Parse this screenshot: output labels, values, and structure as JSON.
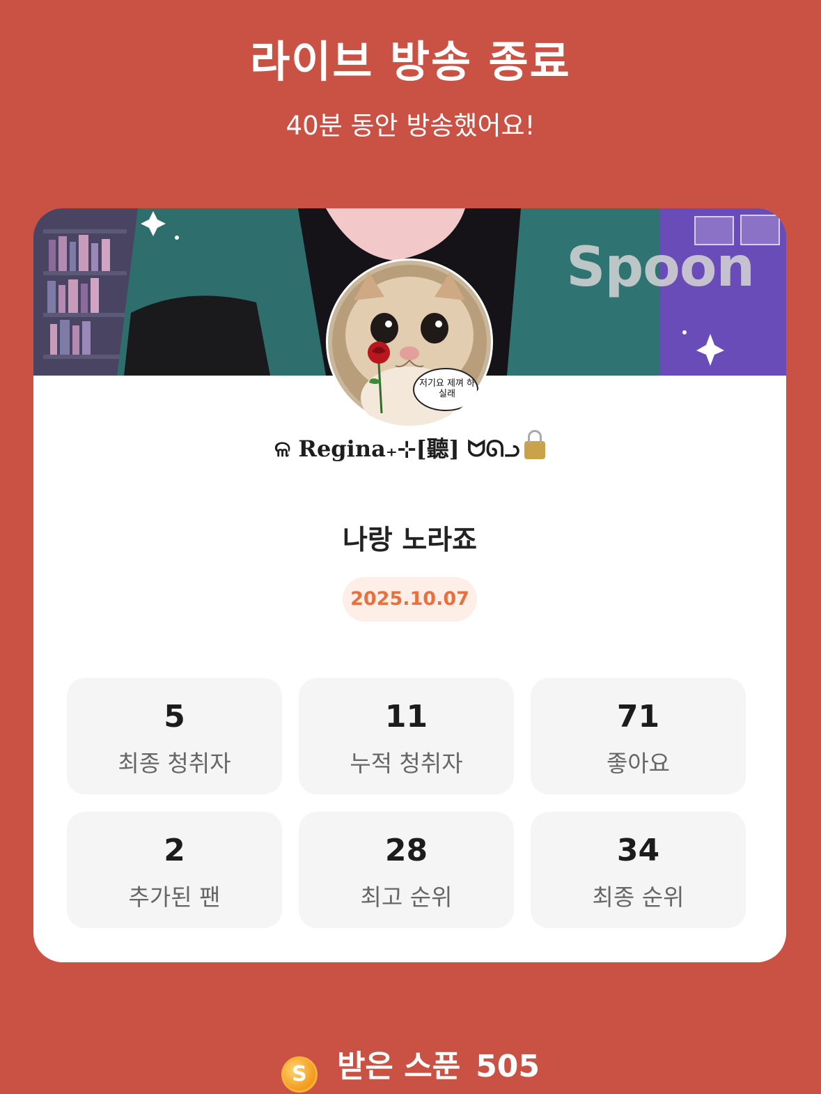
{
  "header": {
    "title": "라이브 방송 종료",
    "subtitle": "40분 동안 방송했어요!"
  },
  "card": {
    "banner_logo": "Spoon",
    "avatar_bubble_text": "저기요 제껴 하실래",
    "username": "ଳ Regina₊⊹[聽] ᗢᘏᓗ",
    "username_lock_icon": "lock-icon",
    "broadcast_title": "나랑 노라죠",
    "date": "2025.10.07"
  },
  "stats": [
    {
      "value": "5",
      "label": "최종 청취자"
    },
    {
      "value": "11",
      "label": "누적 청취자"
    },
    {
      "value": "71",
      "label": "좋아요"
    },
    {
      "value": "2",
      "label": "추가된 팬"
    },
    {
      "value": "28",
      "label": "최고 순위"
    },
    {
      "value": "34",
      "label": "최종 순위"
    }
  ],
  "footer": {
    "coin_icon": "spoon-coin-icon",
    "coin_letter": "S",
    "label": "받은 스푼",
    "count": "505"
  },
  "colors": {
    "background": "#c95244",
    "card": "#ffffff",
    "date_pill_bg": "#fdeee8",
    "date_text": "#e8703e",
    "stat_bg": "#f5f5f5"
  }
}
